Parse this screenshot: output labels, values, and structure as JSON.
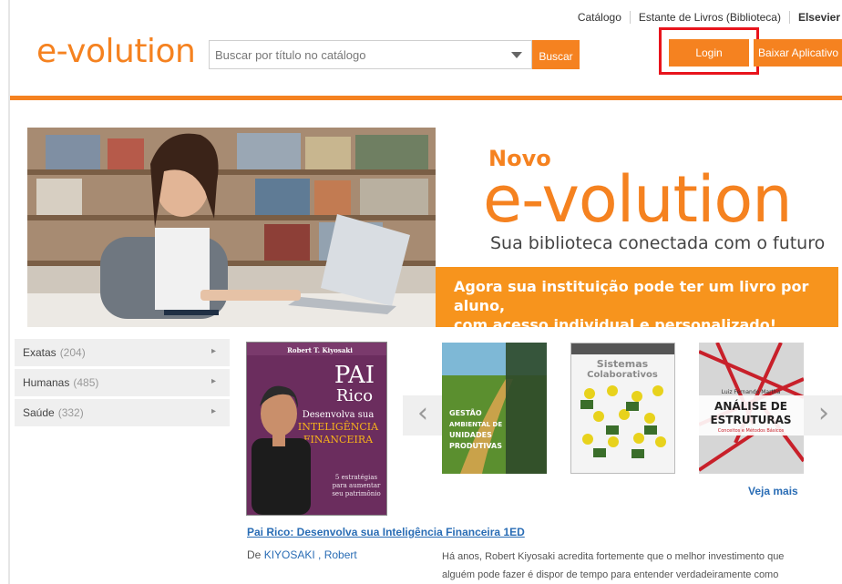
{
  "header": {
    "top_links": [
      "Catálogo",
      "Estante de Livros (Biblioteca)",
      "Elsevier"
    ],
    "logo": "e-volution",
    "search": {
      "placeholder": "Buscar por título no catálogo",
      "button": "Buscar"
    },
    "login_label": "Login",
    "app_button_label": "Baixar Aplicativo"
  },
  "banner": {
    "novo": "Novo",
    "title": "e-volution",
    "subtitle": "Sua biblioteca conectada com o futuro",
    "strip_line1": "Agora sua instituição pode ter um livro por aluno,",
    "strip_line2": "com acesso individual e personalizado!"
  },
  "categories": [
    {
      "label": "Exatas",
      "count": "(204)"
    },
    {
      "label": "Humanas",
      "count": "(485)"
    },
    {
      "label": "Saúde",
      "count": "(332)"
    }
  ],
  "carousel": {
    "books": [
      {
        "cover_author": "Robert T. Kiyosaki",
        "cover_title_1": "PAI",
        "cover_title_2": "Rico",
        "cover_sub_1": "Desenvolva sua",
        "cover_sub_2": "INTELIGÊNCIA",
        "cover_sub_3": "FINANCEIRA",
        "cover_tag_1": "5 estratégias",
        "cover_tag_2": "para aumentar",
        "cover_tag_3": "seu patrimônio"
      },
      {
        "cover_title_1": "GESTÃO",
        "cover_title_2": "AMBIENTAL DE",
        "cover_title_3": "UNIDADES",
        "cover_title_4": "PRODUTIVAS"
      },
      {
        "cover_title_1": "Sistemas",
        "cover_title_2": "Colaborativos"
      },
      {
        "cover_author": "Luiz Fernando Martha",
        "cover_title_1": "ANÁLISE DE",
        "cover_title_2": "ESTRUTURAS",
        "cover_sub": "Conceitos e Métodos Básicos"
      }
    ],
    "prev_glyph": "‹",
    "next_glyph": "›",
    "see_more": "Veja mais"
  },
  "featured": {
    "title": "Pai Rico: Desenvolva sua Inteligência Financeira 1ED",
    "author_prefix": "De",
    "author": "KIYOSAKI , Robert",
    "description_line1": "Há anos, Robert Kiyosaki acredita fortemente que o melhor investimento que",
    "description_line2": "alguém pode fazer é dispor de tempo para entender verdadeiramente como"
  },
  "colors": {
    "brand_orange": "#f58220",
    "link_blue": "#2a6db5",
    "highlight_red": "#e8141c"
  }
}
